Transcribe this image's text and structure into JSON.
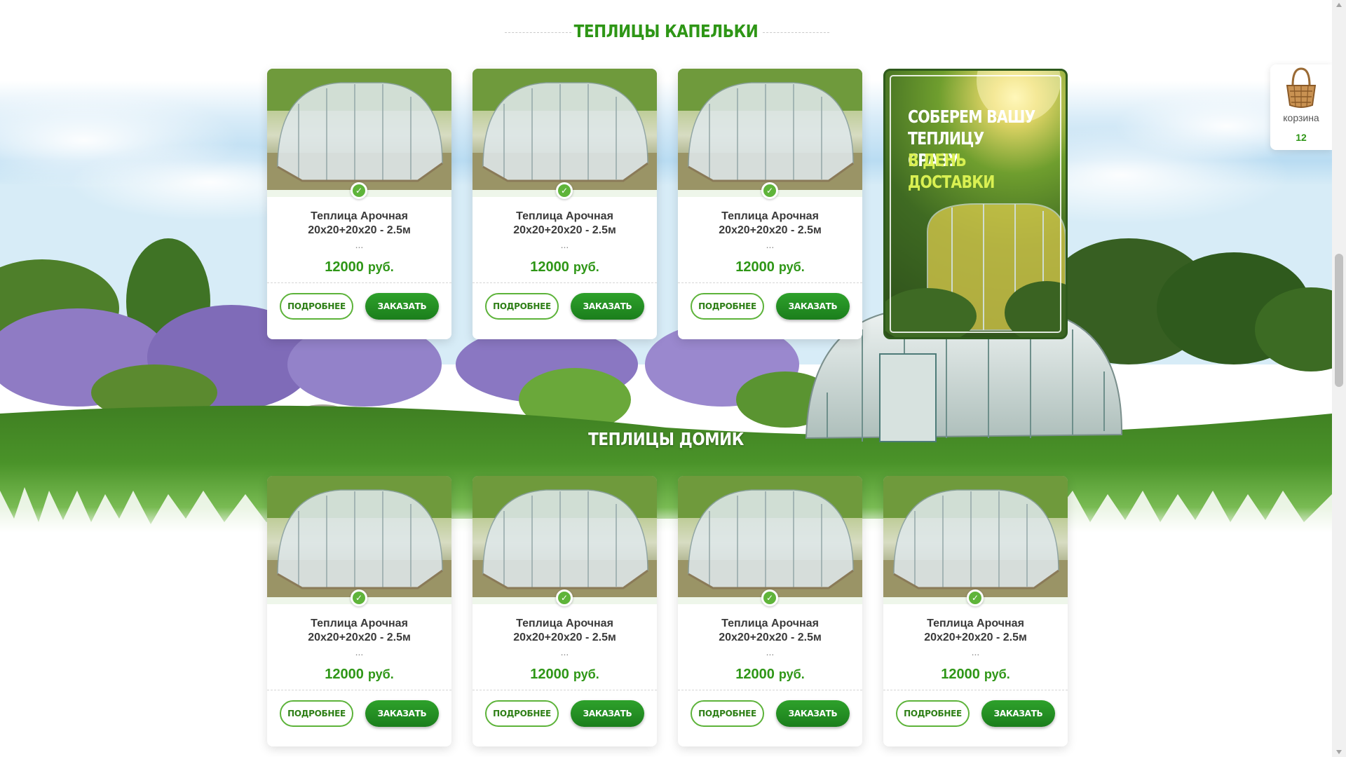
{
  "sections": [
    {
      "title": "ТЕПЛИЦЫ КАПЕЛЬКИ",
      "products": [
        {
          "name_line1": "Теплица Арочная",
          "name_line2": "20x20+20x20 - 2.5м",
          "ellipsis": "...",
          "price": "12000",
          "currency": "руб."
        },
        {
          "name_line1": "Теплица Арочная",
          "name_line2": "20x20+20x20 - 2.5м",
          "ellipsis": "...",
          "price": "12000",
          "currency": "руб."
        },
        {
          "name_line1": "Теплица Арочная",
          "name_line2": "20x20+20x20 - 2.5м",
          "ellipsis": "...",
          "price": "12000",
          "currency": "руб."
        }
      ]
    },
    {
      "title": "ТЕПЛИЦЫ ДОМИК",
      "products": [
        {
          "name_line1": "Теплица Арочная",
          "name_line2": "20x20+20x20 - 2.5м",
          "ellipsis": "...",
          "price": "12000",
          "currency": "руб."
        },
        {
          "name_line1": "Теплица Арочная",
          "name_line2": "20x20+20x20 - 2.5м",
          "ellipsis": "...",
          "price": "12000",
          "currency": "руб."
        },
        {
          "name_line1": "Теплица Арочная",
          "name_line2": "20x20+20x20 - 2.5м",
          "ellipsis": "...",
          "price": "12000",
          "currency": "руб."
        },
        {
          "name_line1": "Теплица Арочная",
          "name_line2": "20x20+20x20 - 2.5м",
          "ellipsis": "...",
          "price": "12000",
          "currency": "руб."
        }
      ]
    }
  ],
  "buttons": {
    "more": "ПОДРОБНЕЕ",
    "order": "ЗАКАЗАТЬ"
  },
  "promo": {
    "line1": "СОБЕРЕМ ВАШУ",
    "line2": "ТЕПЛИЦУ СРАЗУ",
    "line3": "В ДЕНЬ ДОСТАВКИ"
  },
  "cart": {
    "label": "корзина",
    "count": "12",
    "icon": "basket-icon"
  },
  "colors": {
    "brand_green": "#2e9616",
    "button_green": "#1b7e1c",
    "promo_accent": "#d9f052"
  }
}
